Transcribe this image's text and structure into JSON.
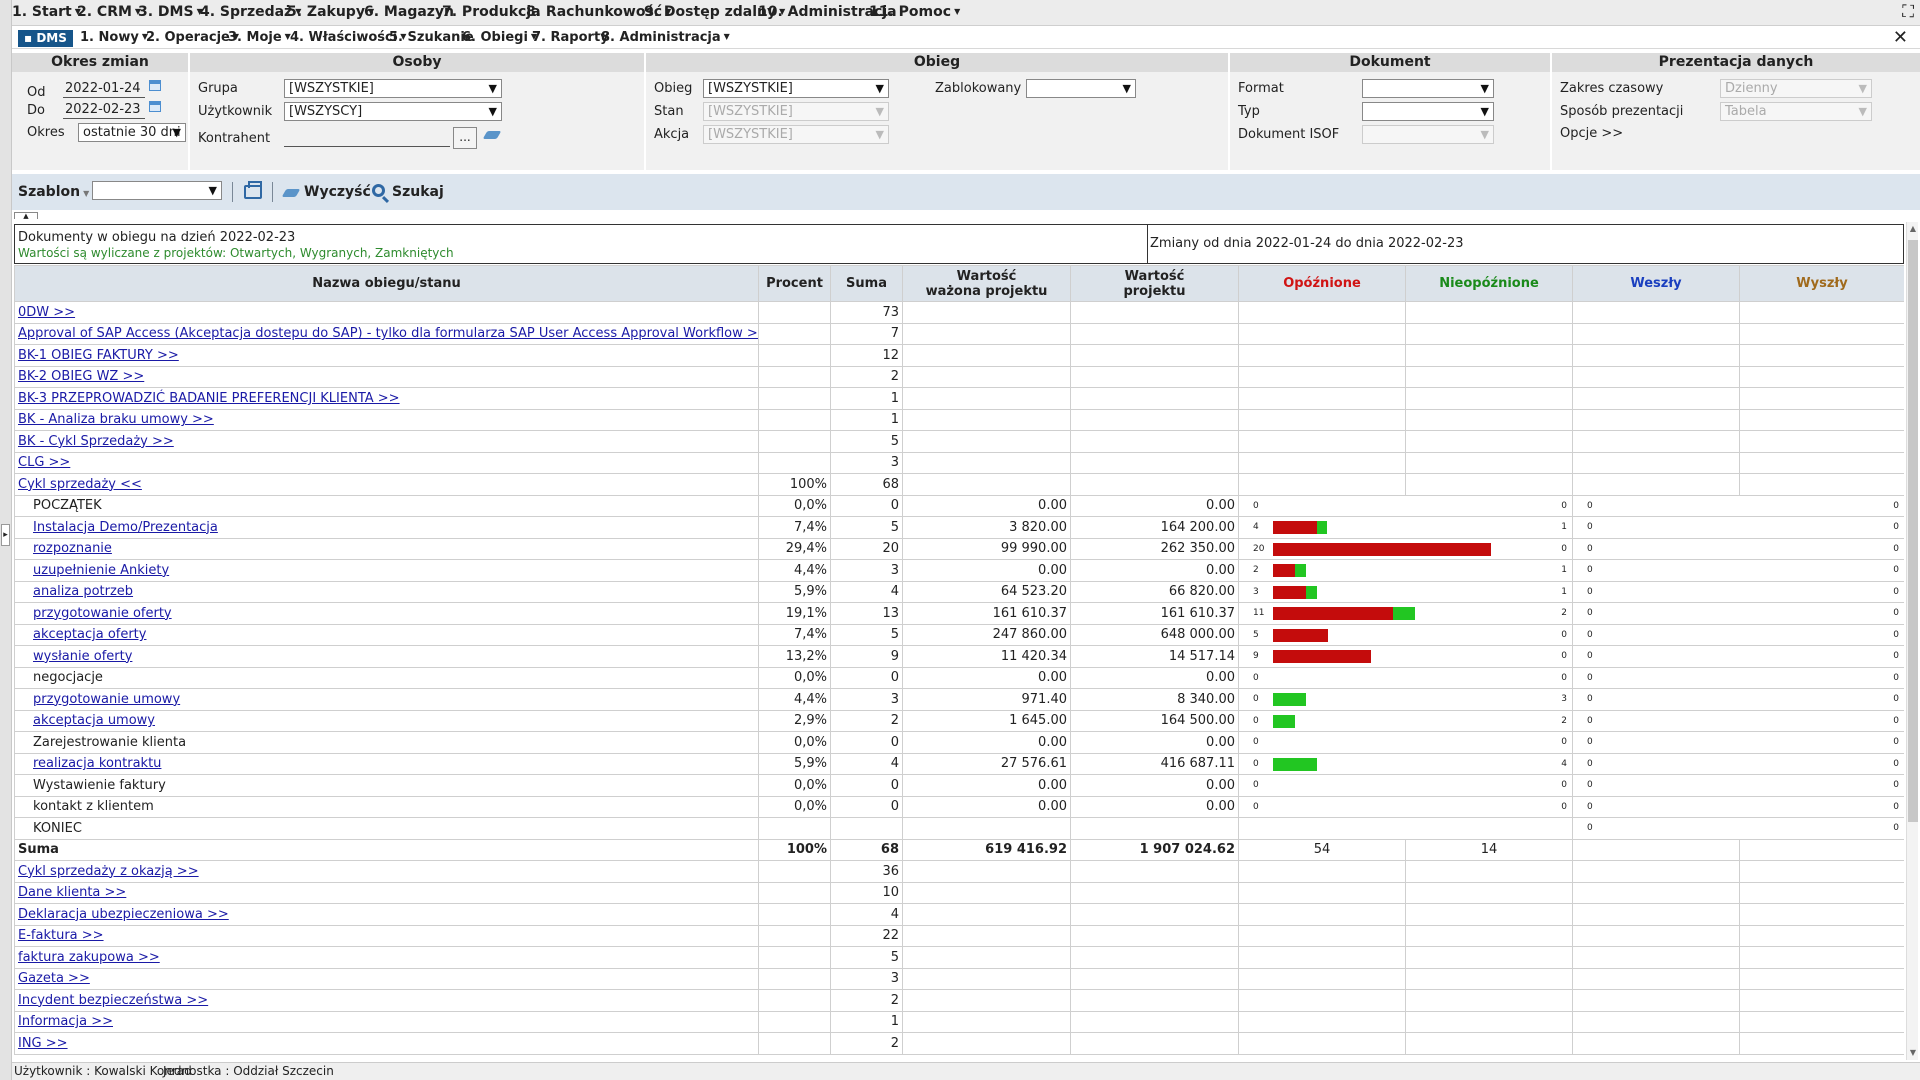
{
  "menu": {
    "items": [
      {
        "label": "1. Start",
        "caret": true
      },
      {
        "label": "2. CRM",
        "caret": true
      },
      {
        "label": "3. DMS",
        "caret": true
      },
      {
        "label": "4. Sprzedaż",
        "caret": true
      },
      {
        "label": "5. Zakupy",
        "caret": true
      },
      {
        "label": "6. Magazyn",
        "caret": false
      },
      {
        "label": "7. Produkcja",
        "caret": false
      },
      {
        "label": "8. Rachunkowość",
        "caret": true
      },
      {
        "label": "9. Dostęp zdalny",
        "caret": true
      },
      {
        "label": "10. Administracja",
        "caret": false
      },
      {
        "label": "11. Pomoc",
        "caret": true
      }
    ]
  },
  "submenu": {
    "active": "DMS",
    "items": [
      {
        "label": "1. Nowy",
        "caret": true
      },
      {
        "label": "2. Operacje",
        "caret": true
      },
      {
        "label": "3. Moje",
        "caret": true
      },
      {
        "label": "4. Właściwości",
        "caret": true
      },
      {
        "label": "5. Szukanie",
        "caret": false
      },
      {
        "label": "6. Obiegi",
        "caret": true
      },
      {
        "label": "7. Raporty",
        "caret": false
      },
      {
        "label": "8. Administracja",
        "caret": true
      }
    ]
  },
  "filters": {
    "okres": {
      "title": "Okres zmian",
      "od_label": "Od",
      "od_value": "2022-01-24",
      "do_label": "Do",
      "do_value": "2022-02-23",
      "okres_label": "Okres",
      "okres_value": "ostatnie 30 dni"
    },
    "osoby": {
      "title": "Osoby",
      "grupa_label": "Grupa",
      "grupa_value": "[WSZYSTKIE]",
      "uzytkownik_label": "Użytkownik",
      "uzytkownik_value": "[WSZYSCY]",
      "kontrahent_label": "Kontrahent",
      "kontrahent_value": "",
      "dots": "..."
    },
    "obieg": {
      "title": "Obieg",
      "obieg_label": "Obieg",
      "obieg_value": "[WSZYSTKIE]",
      "stan_label": "Stan",
      "stan_value": "[WSZYSTKIE]",
      "akcja_label": "Akcja",
      "akcja_value": "[WSZYSTKIE]",
      "zablokowany_label": "Zablokowany",
      "zablokowany_value": ""
    },
    "dokument": {
      "title": "Dokument",
      "format_label": "Format",
      "format_value": "",
      "typ_label": "Typ",
      "typ_value": "",
      "isof_label": "Dokument ISOF",
      "isof_value": ""
    },
    "prezentacja": {
      "title": "Prezentacja danych",
      "zakres_label": "Zakres czasowy",
      "zakres_value": "Dzienny",
      "sposob_label": "Sposób prezentacji",
      "sposob_value": "Tabela",
      "opcje_label": "Opcje >>"
    }
  },
  "toolbar": {
    "szablon_label": "Szablon",
    "szablon_value": "",
    "clear_label": "Wyczyść",
    "search_label": "Szukaj"
  },
  "info": {
    "line1": "Dokumenty w obiegu na dzień 2022-02-23",
    "line2": "Wartości są wyliczane z projektów: Otwartych, Wygranych, Zamkniętych",
    "changes": "Zmiany od dnia 2022-01-24 do dnia 2022-02-23"
  },
  "table": {
    "headers": {
      "name": "Nazwa obiegu/stanu",
      "percent": "Procent",
      "sum": "Suma",
      "weighted_1": "Wartość",
      "weighted_2": "ważona projektu",
      "value_1": "Wartość",
      "value_2": "projektu",
      "late": "Opóźnione",
      "ontime": "Nieopóźnione",
      "in": "Weszły",
      "out": "Wyszły"
    },
    "rows": [
      {
        "kind": "obieg",
        "name": "0DW >>",
        "sum": "73"
      },
      {
        "kind": "obieg",
        "name": "Approval of SAP Access (Akceptacja dostepu do SAP) - tylko dla formularza SAP User Access Approval Workflow >>",
        "sum": "7"
      },
      {
        "kind": "obieg",
        "name": "BK-1 OBIEG FAKTURY >>",
        "sum": "12"
      },
      {
        "kind": "obieg",
        "name": "BK-2 OBIEG WZ >>",
        "sum": "2"
      },
      {
        "kind": "obieg",
        "name": "BK-3 PRZEPROWADZIĆ BADANIE PREFERENCJI KLIENTA >>",
        "sum": "1"
      },
      {
        "kind": "obieg",
        "name": "BK - Analiza braku umowy >>",
        "sum": "1"
      },
      {
        "kind": "obieg",
        "name": "BK - Cykl Sprzedaży >>",
        "sum": "5"
      },
      {
        "kind": "obieg",
        "name": "CLG >>",
        "sum": "3"
      },
      {
        "kind": "obieg",
        "name": "Cykl sprzedaży <<",
        "percent": "100%",
        "sum": "68"
      },
      {
        "kind": "stage",
        "link": false,
        "name": "POCZĄTEK",
        "percent": "0,0%",
        "sum": "0",
        "weighted": "0.00",
        "value": "0.00",
        "late": 0,
        "ontime": 0,
        "in": 0,
        "out": 0
      },
      {
        "kind": "stage",
        "link": true,
        "name": "Instalacja Demo/Prezentacja",
        "percent": "7,4%",
        "sum": "5",
        "weighted": "3 820.00",
        "value": "164 200.00",
        "late": 4,
        "ontime": 1,
        "in": 0,
        "out": 0
      },
      {
        "kind": "stage",
        "link": true,
        "name": "rozpoznanie",
        "percent": "29,4%",
        "sum": "20",
        "weighted": "99 990.00",
        "value": "262 350.00",
        "late": 20,
        "ontime": 0,
        "in": 0,
        "out": 0
      },
      {
        "kind": "stage",
        "link": true,
        "name": "uzupełnienie Ankiety",
        "percent": "4,4%",
        "sum": "3",
        "weighted": "0.00",
        "value": "0.00",
        "late": 2,
        "ontime": 1,
        "in": 0,
        "out": 0
      },
      {
        "kind": "stage",
        "link": true,
        "name": "analiza potrzeb",
        "percent": "5,9%",
        "sum": "4",
        "weighted": "64 523.20",
        "value": "66 820.00",
        "late": 3,
        "ontime": 1,
        "in": 0,
        "out": 0
      },
      {
        "kind": "stage",
        "link": true,
        "name": "przygotowanie oferty",
        "percent": "19,1%",
        "sum": "13",
        "weighted": "161 610.37",
        "value": "161 610.37",
        "late": 11,
        "ontime": 2,
        "in": 0,
        "out": 0
      },
      {
        "kind": "stage",
        "link": true,
        "name": "akceptacja oferty",
        "percent": "7,4%",
        "sum": "5",
        "weighted": "247 860.00",
        "value": "648 000.00",
        "late": 5,
        "ontime": 0,
        "in": 0,
        "out": 0
      },
      {
        "kind": "stage",
        "link": true,
        "name": "wysłanie oferty",
        "percent": "13,2%",
        "sum": "9",
        "weighted": "11 420.34",
        "value": "14 517.14",
        "late": 9,
        "ontime": 0,
        "in": 0,
        "out": 0
      },
      {
        "kind": "stage",
        "link": false,
        "name": "negocjacje",
        "percent": "0,0%",
        "sum": "0",
        "weighted": "0.00",
        "value": "0.00",
        "late": 0,
        "ontime": 0,
        "in": 0,
        "out": 0
      },
      {
        "kind": "stage",
        "link": true,
        "name": "przygotowanie umowy",
        "percent": "4,4%",
        "sum": "3",
        "weighted": "971.40",
        "value": "8 340.00",
        "late": 0,
        "ontime": 3,
        "in": 0,
        "out": 0
      },
      {
        "kind": "stage",
        "link": true,
        "name": "akceptacja umowy",
        "percent": "2,9%",
        "sum": "2",
        "weighted": "1 645.00",
        "value": "164 500.00",
        "late": 0,
        "ontime": 2,
        "in": 0,
        "out": 0
      },
      {
        "kind": "stage",
        "link": false,
        "name": "Zarejestrowanie klienta",
        "percent": "0,0%",
        "sum": "0",
        "weighted": "0.00",
        "value": "0.00",
        "late": 0,
        "ontime": 0,
        "in": 0,
        "out": 0
      },
      {
        "kind": "stage",
        "link": true,
        "name": "realizacja kontraktu",
        "percent": "5,9%",
        "sum": "4",
        "weighted": "27 576.61",
        "value": "416 687.11",
        "late": 0,
        "ontime": 4,
        "in": 0,
        "out": 0
      },
      {
        "kind": "stage",
        "link": false,
        "name": "Wystawienie faktury",
        "percent": "0,0%",
        "sum": "0",
        "weighted": "0.00",
        "value": "0.00",
        "late": 0,
        "ontime": 0,
        "in": 0,
        "out": 0
      },
      {
        "kind": "stage",
        "link": false,
        "name": "kontakt z klientem",
        "percent": "0,0%",
        "sum": "0",
        "weighted": "0.00",
        "value": "0.00",
        "late": 0,
        "ontime": 0,
        "in": 0,
        "out": 0
      },
      {
        "kind": "end",
        "link": false,
        "name": "KONIEC",
        "in": 0,
        "out": 0
      },
      {
        "kind": "total",
        "name": "Suma",
        "percent": "100%",
        "sum": "68",
        "weighted": "619 416.92",
        "value": "1 907 024.62",
        "late_total": "54",
        "ontime_total": "14"
      },
      {
        "kind": "obieg",
        "name": "Cykl sprzedaży z okazją >>",
        "sum": "36"
      },
      {
        "kind": "obieg",
        "name": "Dane klienta >>",
        "sum": "10"
      },
      {
        "kind": "obieg",
        "name": "Deklaracja ubezpieczeniowa >>",
        "sum": "4"
      },
      {
        "kind": "obieg",
        "name": "E-faktura >>",
        "sum": "22"
      },
      {
        "kind": "obieg",
        "name": "faktura zakupowa >>",
        "sum": "5"
      },
      {
        "kind": "obieg",
        "name": "Gazeta >>",
        "sum": "3"
      },
      {
        "kind": "obieg",
        "name": "Incydent bezpieczeństwa >>",
        "sum": "2"
      },
      {
        "kind": "obieg",
        "name": "Informacja >>",
        "sum": "1"
      },
      {
        "kind": "obieg",
        "name": "ING >>",
        "sum": "2"
      }
    ]
  },
  "statusbar": {
    "user": "Użytkownik : Kowalski Konrad",
    "unit": "Jednostka : Oddział Szczecin"
  }
}
